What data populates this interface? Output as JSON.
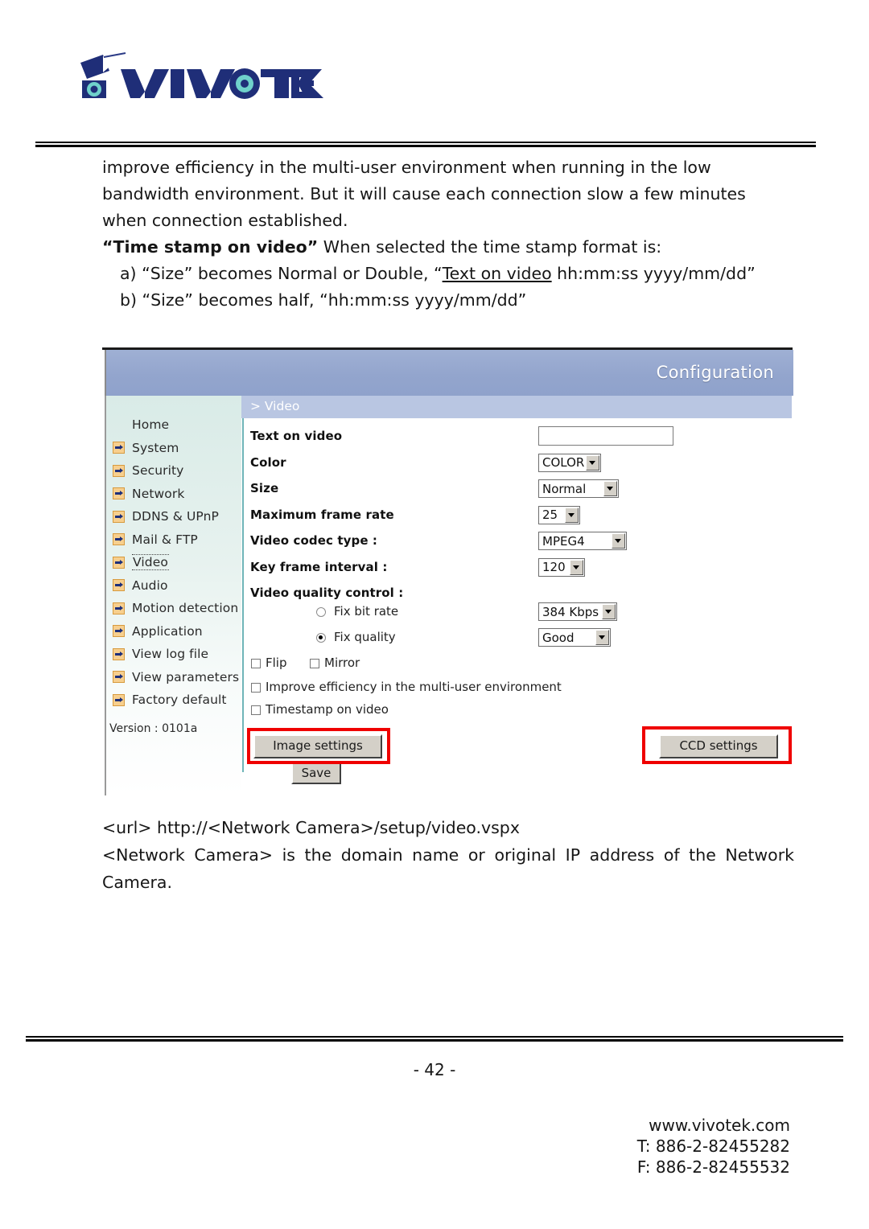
{
  "brand": {
    "logo_text": "VIVOTEK",
    "logo_icon": "camera-eye-icon"
  },
  "document": {
    "paragraph1": "improve efficiency in the multi-user environment when running in the low bandwidth environment. But it will cause each connection slow a few minutes when connection established.",
    "timestamp_heading": "“Time stamp on video”",
    "timestamp_rest": " When selected the time stamp format is:",
    "item_a_pre": "a) “Size” becomes Normal or Double, “",
    "item_a_underline": "Text on video",
    "item_a_post": " hh:mm:ss yyyy/mm/dd”",
    "item_b": "b) “Size” becomes half, “hh:mm:ss yyyy/mm/dd”",
    "url_line": "<url> http://<Network Camera>/setup/video.vspx",
    "desc_line1": "<Network Camera> is the domain name or original IP address of the Network",
    "desc_line2": "Camera."
  },
  "screenshot": {
    "header_title": "Configuration",
    "panel_title": "> Video",
    "sidebar": {
      "items": [
        {
          "label": "Home",
          "icon": "none",
          "selected": false
        },
        {
          "label": "System",
          "icon": "arrow-icon",
          "selected": false
        },
        {
          "label": "Security",
          "icon": "arrow-icon",
          "selected": false
        },
        {
          "label": "Network",
          "icon": "arrow-icon",
          "selected": false
        },
        {
          "label": "DDNS & UPnP",
          "icon": "arrow-icon",
          "selected": false
        },
        {
          "label": "Mail & FTP",
          "icon": "arrow-icon",
          "selected": false
        },
        {
          "label": "Video",
          "icon": "arrow-icon",
          "selected": true
        },
        {
          "label": "Audio",
          "icon": "arrow-icon",
          "selected": false
        },
        {
          "label": "Motion detection",
          "icon": "arrow-icon",
          "selected": false
        },
        {
          "label": "Application",
          "icon": "arrow-icon",
          "selected": false
        },
        {
          "label": "View log file",
          "icon": "arrow-icon",
          "selected": false
        },
        {
          "label": "View parameters",
          "icon": "arrow-icon",
          "selected": false
        },
        {
          "label": "Factory default",
          "icon": "arrow-icon",
          "selected": false
        }
      ],
      "version": "Version : 0101a"
    },
    "form": {
      "text_on_video_label": "Text on video",
      "text_on_video_value": "",
      "color_label": "Color",
      "color_value": "COLOR",
      "size_label": "Size",
      "size_value": "Normal",
      "max_frame_rate_label": "Maximum frame rate",
      "max_frame_rate_value": "25",
      "codec_label": "Video codec type :",
      "codec_value": "MPEG4",
      "key_frame_label": "Key frame interval :",
      "key_frame_value": "120",
      "quality_control_label": "Video quality control :",
      "fix_bit_rate_label": "Fix bit rate",
      "fix_bit_rate_selected": false,
      "fix_bit_rate_value": "384 Kbps",
      "fix_quality_label": "Fix quality",
      "fix_quality_selected": true,
      "fix_quality_value": "Good",
      "flip_label": "Flip",
      "flip_checked": false,
      "mirror_label": "Mirror",
      "mirror_checked": false,
      "improve_label": "Improve efficiency in the multi-user environment",
      "improve_checked": false,
      "timestamp_label": "Timestamp on video",
      "timestamp_checked": false,
      "image_settings_button": "Image settings",
      "ccd_settings_button": "CCD settings",
      "save_button": "Save"
    }
  },
  "footer": {
    "page_number": "- 42 -",
    "website": "www.vivotek.com",
    "phone": "T: 886-2-82455282",
    "fax": "F: 886-2-82455532"
  },
  "colors": {
    "header_blue": "#93a5cd",
    "subbar_blue": "#b9c6e2",
    "sidebar_mint": "#d9ebe7",
    "highlight_red": "#ef0000",
    "icon_orange": "#f7cf8e",
    "teal_divider": "#6fb5b8"
  }
}
